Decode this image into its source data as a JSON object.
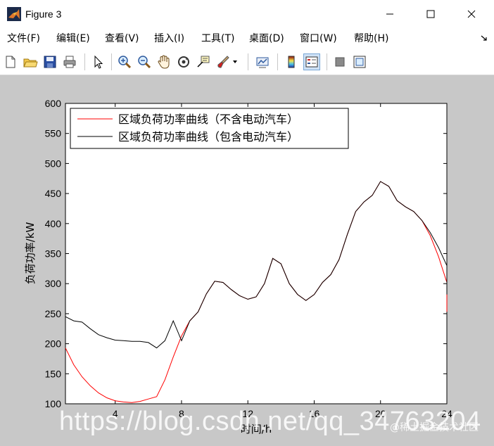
{
  "window": {
    "title": "Figure 3",
    "buttons": [
      "minimize",
      "maximize",
      "close"
    ]
  },
  "menu": [
    {
      "label": "文件(F)"
    },
    {
      "label": "编辑(E)"
    },
    {
      "label": "查看(V)"
    },
    {
      "label": "插入(I)"
    },
    {
      "label": "工具(T)"
    },
    {
      "label": "桌面(D)"
    },
    {
      "label": "窗口(W)"
    },
    {
      "label": "帮助(H)"
    }
  ],
  "toolbar": [
    "new-figure-icon",
    "open-file-icon",
    "save-icon",
    "print-icon",
    "pointer-icon",
    "zoom-in-icon",
    "zoom-out-icon",
    "pan-hand-icon",
    "rotate-3d-icon",
    "data-cursor-icon",
    "brush-icon",
    "link-plot-icon",
    "colorbar-icon",
    "legend-icon",
    "hide-plot-tools-icon",
    "show-plot-tools-icon"
  ],
  "chart_data": {
    "type": "line",
    "xlabel": "时间/h",
    "ylabel": "负荷功率/kW",
    "xlim": [
      1,
      24
    ],
    "ylim": [
      100,
      600
    ],
    "xticks": [
      4,
      8,
      12,
      16,
      20,
      24
    ],
    "yticks": [
      100,
      150,
      200,
      250,
      300,
      350,
      400,
      450,
      500,
      550,
      600
    ],
    "legend_position": "top-left",
    "series": [
      {
        "name": "区域负荷功率曲线（不含电动汽车）",
        "color": "#ff0000",
        "points": [
          [
            1,
            193
          ],
          [
            1.5,
            165
          ],
          [
            2,
            145
          ],
          [
            2.5,
            130
          ],
          [
            3,
            118
          ],
          [
            3.5,
            110
          ],
          [
            4,
            105
          ],
          [
            4.5,
            103
          ],
          [
            5,
            102
          ],
          [
            5.5,
            104
          ],
          [
            6,
            108
          ],
          [
            6.5,
            112
          ],
          [
            7,
            140
          ],
          [
            7.5,
            178
          ],
          [
            8,
            213
          ],
          [
            8.5,
            238
          ],
          [
            9,
            253
          ],
          [
            9.5,
            283
          ],
          [
            10,
            304
          ],
          [
            10.5,
            302
          ],
          [
            11,
            290
          ],
          [
            11.5,
            280
          ],
          [
            12,
            274
          ],
          [
            12.5,
            278
          ],
          [
            13,
            300
          ],
          [
            13.5,
            342
          ],
          [
            14,
            333
          ],
          [
            14.5,
            300
          ],
          [
            15,
            282
          ],
          [
            15.5,
            272
          ],
          [
            16,
            282
          ],
          [
            16.5,
            302
          ],
          [
            17,
            315
          ],
          [
            17.5,
            340
          ],
          [
            18,
            382
          ],
          [
            18.5,
            420
          ],
          [
            19,
            436
          ],
          [
            19.5,
            447
          ],
          [
            20,
            470
          ],
          [
            20.5,
            462
          ],
          [
            21,
            438
          ],
          [
            21.5,
            428
          ],
          [
            22,
            420
          ],
          [
            22.5,
            405
          ],
          [
            23,
            380
          ],
          [
            23.5,
            345
          ],
          [
            24,
            302
          ],
          [
            24.2,
            253
          ]
        ]
      },
      {
        "name": "区域负荷功率曲线（包含电动汽车）",
        "color": "#000000",
        "points": [
          [
            1,
            245
          ],
          [
            1.5,
            238
          ],
          [
            2,
            236
          ],
          [
            2.5,
            225
          ],
          [
            3,
            215
          ],
          [
            3.5,
            210
          ],
          [
            4,
            206
          ],
          [
            4.5,
            205
          ],
          [
            5,
            204
          ],
          [
            5.5,
            204
          ],
          [
            6,
            202
          ],
          [
            6.5,
            193
          ],
          [
            7,
            205
          ],
          [
            7.5,
            238
          ],
          [
            8,
            205
          ],
          [
            8.5,
            238
          ],
          [
            9,
            253
          ],
          [
            9.5,
            283
          ],
          [
            10,
            304
          ],
          [
            10.5,
            302
          ],
          [
            11,
            290
          ],
          [
            11.5,
            280
          ],
          [
            12,
            274
          ],
          [
            12.5,
            278
          ],
          [
            13,
            300
          ],
          [
            13.5,
            342
          ],
          [
            14,
            333
          ],
          [
            14.5,
            300
          ],
          [
            15,
            282
          ],
          [
            15.5,
            272
          ],
          [
            16,
            282
          ],
          [
            16.5,
            302
          ],
          [
            17,
            315
          ],
          [
            17.5,
            340
          ],
          [
            18,
            382
          ],
          [
            18.5,
            420
          ],
          [
            19,
            436
          ],
          [
            19.5,
            447
          ],
          [
            20,
            470
          ],
          [
            20.5,
            462
          ],
          [
            21,
            438
          ],
          [
            21.5,
            428
          ],
          [
            22,
            420
          ],
          [
            22.5,
            405
          ],
          [
            23,
            385
          ],
          [
            23.5,
            360
          ],
          [
            24,
            330
          ],
          [
            24.2,
            282
          ]
        ]
      }
    ]
  },
  "watermark": {
    "url": "https://blog.csdn.net/qq_34763204",
    "tag": "@稀土掘金技术社区"
  }
}
